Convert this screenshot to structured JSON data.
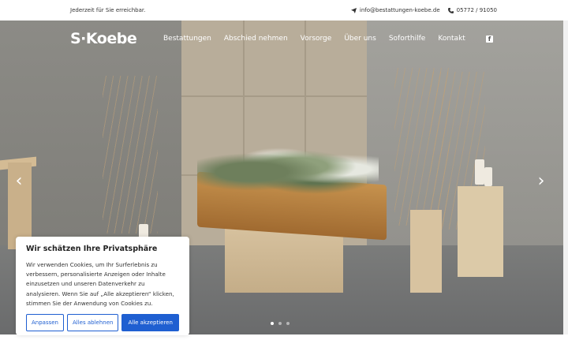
{
  "topbar": {
    "tagline": "Jederzeit für Sie erreichbar.",
    "email": "info@bestattungen-koebe.de",
    "phone": "05772 / 91050",
    "email_icon": "paper-plane-icon",
    "phone_icon": "phone-icon"
  },
  "header": {
    "logo": "S·Koebe",
    "nav": [
      "Bestattungen",
      "Abschied nehmen",
      "Vorsorge",
      "Über uns",
      "Soforthilfe",
      "Kontakt"
    ],
    "social_icon": "facebook-icon"
  },
  "slider": {
    "prev_icon": "chevron-left-icon",
    "next_icon": "chevron-right-icon",
    "slide_count": 3,
    "active_slide": 1
  },
  "cookie": {
    "title": "Wir schätzen Ihre Privatsphäre",
    "text": "Wir verwenden Cookies, um Ihr Surferlebnis zu verbessern, personalisierte Anzeigen oder Inhalte einzusetzen und unseren Datenverkehr zu analysieren. Wenn Sie auf „Alle akzeptieren“ klicken, stimmen Sie der Anwendung von Cookies zu.",
    "customize": "Anpassen",
    "reject": "Alles ablehnen",
    "accept": "Alle akzeptieren"
  },
  "colors": {
    "accent": "#1f5fd1"
  }
}
